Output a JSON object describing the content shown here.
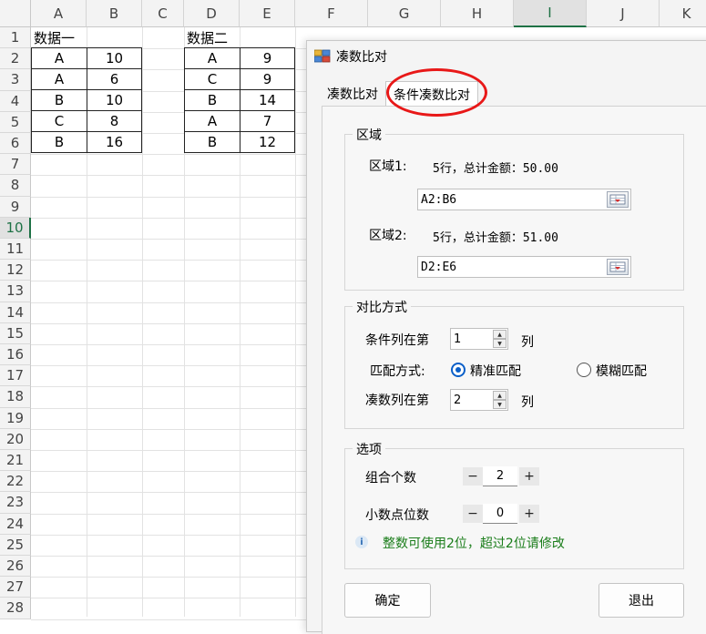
{
  "sheet": {
    "columns": [
      "A",
      "B",
      "C",
      "D",
      "E",
      "F",
      "G",
      "H",
      "I",
      "J",
      "K"
    ],
    "selected_column": "I",
    "rows": [
      "1",
      "2",
      "3",
      "4",
      "5",
      "6",
      "7",
      "8",
      "9",
      "10",
      "11",
      "12",
      "13",
      "14",
      "15",
      "16",
      "17",
      "18",
      "19",
      "20",
      "21",
      "22",
      "23",
      "24",
      "25",
      "26",
      "27",
      "28"
    ],
    "selected_row": "10",
    "table1": {
      "title": "数据一",
      "rows": [
        [
          "A",
          "10"
        ],
        [
          "A",
          "6"
        ],
        [
          "B",
          "10"
        ],
        [
          "C",
          "8"
        ],
        [
          "B",
          "16"
        ]
      ]
    },
    "table2": {
      "title": "数据二",
      "rows": [
        [
          "A",
          "9"
        ],
        [
          "C",
          "9"
        ],
        [
          "B",
          "14"
        ],
        [
          "A",
          "7"
        ],
        [
          "B",
          "12"
        ]
      ]
    }
  },
  "dialog": {
    "title": "凑数比对",
    "tabs": [
      {
        "label": "凑数比对",
        "active": false
      },
      {
        "label": "条件凑数比对",
        "active": true
      }
    ],
    "region_group": {
      "title": "区域",
      "region1_label": "区域1:",
      "region1_info": "5行，总计金额：50.00",
      "region1_value": "A2:B6",
      "region2_label": "区域2:",
      "region2_info": "5行，总计金额：51.00",
      "region2_value": "D2:E6"
    },
    "compare_group": {
      "title": "对比方式",
      "condition_col_label": "条件列在第",
      "condition_col_value": "1",
      "col_unit": "列",
      "match_label": "匹配方式:",
      "match_exact": "精准匹配",
      "match_fuzzy": "模糊匹配",
      "match_selected": "exact",
      "sum_col_label": "凑数列在第",
      "sum_col_value": "2",
      "col_unit2": "列"
    },
    "options_group": {
      "title": "选项",
      "combo_label": "组合个数",
      "combo_value": "2",
      "decimal_label": "小数点位数",
      "decimal_value": "0",
      "minus": "−",
      "plus": "+",
      "info_text": "整数可使用2位，超过2位请修改"
    },
    "ok_label": "确定",
    "exit_label": "退出"
  },
  "colors": {
    "highlight_ellipse": "#e81818",
    "info_text": "#1a7d1a",
    "radio_accent": "#0a5fc8",
    "selected_header": "#1e7145"
  }
}
